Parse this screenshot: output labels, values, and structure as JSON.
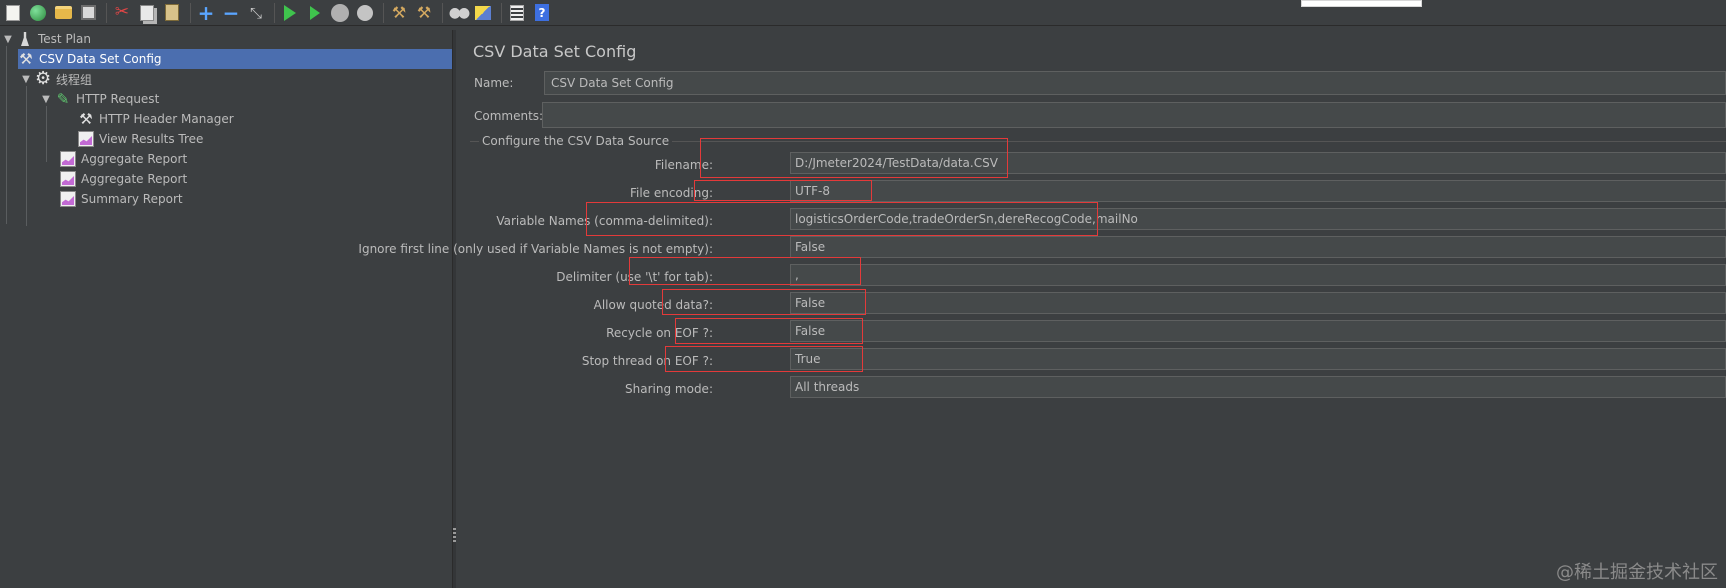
{
  "toolbar": {
    "icons": [
      "new-icon",
      "templates-icon",
      "open-icon",
      "save-icon",
      "cut-icon",
      "copy-icon",
      "paste-icon",
      "expand-icon",
      "collapse-icon",
      "toggle-icon",
      "start-icon",
      "start-no-pause-icon",
      "stop-icon",
      "shutdown-icon",
      "clear-icon",
      "clear-all-icon",
      "search-icon",
      "reset-search-icon",
      "function-helper-icon",
      "help-icon"
    ]
  },
  "tree": {
    "items": [
      {
        "label": "Test Plan"
      },
      {
        "label": "CSV Data Set Config"
      },
      {
        "label": "线程组"
      },
      {
        "label": "HTTP Request"
      },
      {
        "label": "HTTP Header Manager"
      },
      {
        "label": "View Results Tree"
      },
      {
        "label": "Aggregate Report"
      },
      {
        "label": "Aggregate Report"
      },
      {
        "label": "Summary Report"
      }
    ]
  },
  "panel": {
    "title": "CSV Data Set Config",
    "name_label": "Name:",
    "name_value": "CSV Data Set Config",
    "comments_label": "Comments:",
    "comments_value": "",
    "group_title": "Configure the CSV Data Source",
    "fields": [
      {
        "label": "Filename:",
        "value": "D:/Jmeter2024/TestData/data.CSV"
      },
      {
        "label": "File encoding:",
        "value": "UTF-8"
      },
      {
        "label": "Variable Names (comma-delimited):",
        "value": "logisticsOrderCode,tradeOrderSn,dereRecogCode,mailNo"
      },
      {
        "label": "Ignore first line (only used if Variable Names is not empty):",
        "value": "False"
      },
      {
        "label": "Delimiter (use '\\t' for tab):",
        "value": ","
      },
      {
        "label": "Allow quoted data?:",
        "value": "False"
      },
      {
        "label": "Recycle on EOF ?:",
        "value": "False"
      },
      {
        "label": "Stop thread on EOF ?:",
        "value": "True"
      },
      {
        "label": "Sharing mode:",
        "value": "All threads"
      }
    ]
  },
  "watermark": "@稀土掘金技术社区",
  "colors": {
    "background": "#3c3f41",
    "selection": "#4b6eaf",
    "highlight_box": "#e33a3a"
  }
}
